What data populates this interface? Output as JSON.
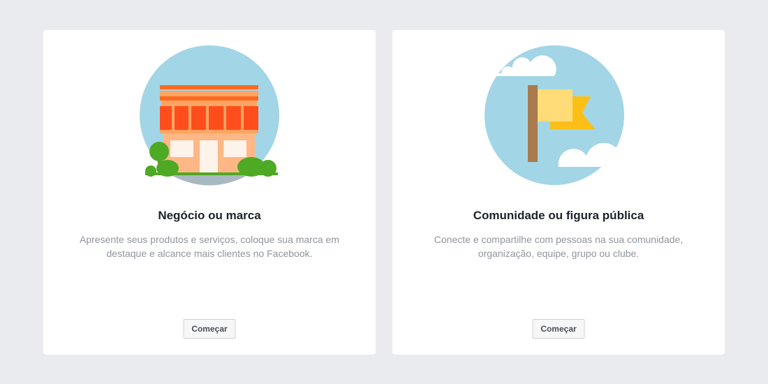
{
  "colors": {
    "page_background": "#e9ebee",
    "card_background": "#ffffff",
    "sky_blue": "#a2d5e6",
    "title": "#1d2129",
    "description": "#90949c"
  },
  "cards": [
    {
      "title": "Negócio ou marca",
      "description": "Apresente seus produtos e serviços, coloque sua marca em destaque e alcance mais clientes no Facebook.",
      "button_label": "Começar",
      "illustration_icon": "storefront-icon"
    },
    {
      "title": "Comunidade ou figura pública",
      "description": "Conecte e compartilhe com pessoas na sua comunidade, organização, equipe, grupo ou clube.",
      "button_label": "Começar",
      "illustration_icon": "flag-icon"
    }
  ]
}
